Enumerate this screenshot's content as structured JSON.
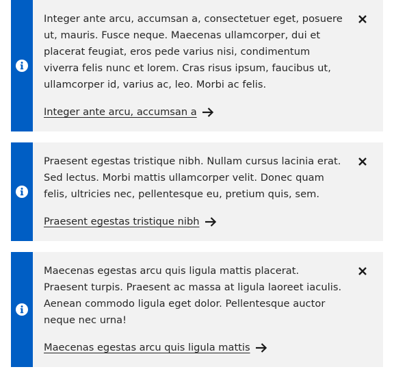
{
  "colors": {
    "accent": "#005ec4",
    "panel_background": "#f2f2f2",
    "text": "#262626"
  },
  "notifications": [
    {
      "icon": "info-icon",
      "message": "Integer ante arcu, accumsan a, consectetuer eget, posuere ut, mauris. Fusce neque. Maecenas ullamcorper, dui et placerat feugiat, eros pede varius nisi, condimentum viverra felis nunc et lorem. Cras risus ipsum, faucibus ut, ullamcorper id, varius ac, leo. Morbi ac felis.",
      "link_label": "Integer ante arcu, accumsan a",
      "link_icon": "arrow-right-icon",
      "close_icon": "close-icon"
    },
    {
      "icon": "info-icon",
      "message": "Praesent egestas tristique nibh. Nullam cursus lacinia erat. Sed lectus. Morbi mattis ullamcorper velit. Donec quam felis, ultricies nec, pellentesque eu, pretium quis, sem.",
      "link_label": "Praesent egestas tristique nibh",
      "link_icon": "arrow-right-icon",
      "close_icon": "close-icon"
    },
    {
      "icon": "info-icon",
      "message": "Maecenas egestas arcu quis ligula mattis placerat. Praesent turpis. Praesent ac massa at ligula laoreet iaculis. Aenean commodo ligula eget dolor. Pellentesque auctor neque nec urna!",
      "link_label": "Maecenas egestas arcu quis ligula mattis",
      "link_icon": "arrow-right-icon",
      "close_icon": "close-icon"
    }
  ]
}
